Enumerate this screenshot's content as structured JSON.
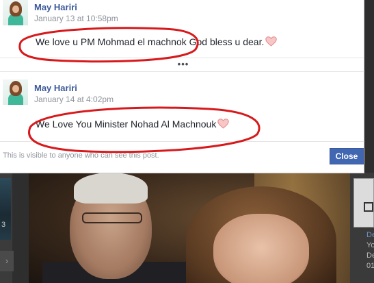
{
  "dialog": {
    "comments": [
      {
        "author": "May Hariri",
        "timestamp": "January 13 at 10:58pm",
        "text": "We love u PM Mohmad el machnok God bless u dear."
      },
      {
        "author": "May Hariri",
        "timestamp": "January 14 at 4:02pm",
        "text": "We Love You Minister Nohad Al Machnouk"
      }
    ],
    "more_indicator": "•••",
    "visibility_note": "This is visible to anyone who can see this post.",
    "close_label": "Close"
  },
  "background": {
    "left_thumb_label": "3",
    "left_arrow": "›",
    "right_texts": [
      "De",
      "Yo",
      "De",
      "01"
    ]
  },
  "colors": {
    "author_link": "#3b5998",
    "close_button": "#4267b2",
    "annotation_ellipse": "#d7191c",
    "heart": "#f2a3a3"
  },
  "icons": {
    "heart": "heart-emoji-icon",
    "more": "more-dots-icon"
  }
}
